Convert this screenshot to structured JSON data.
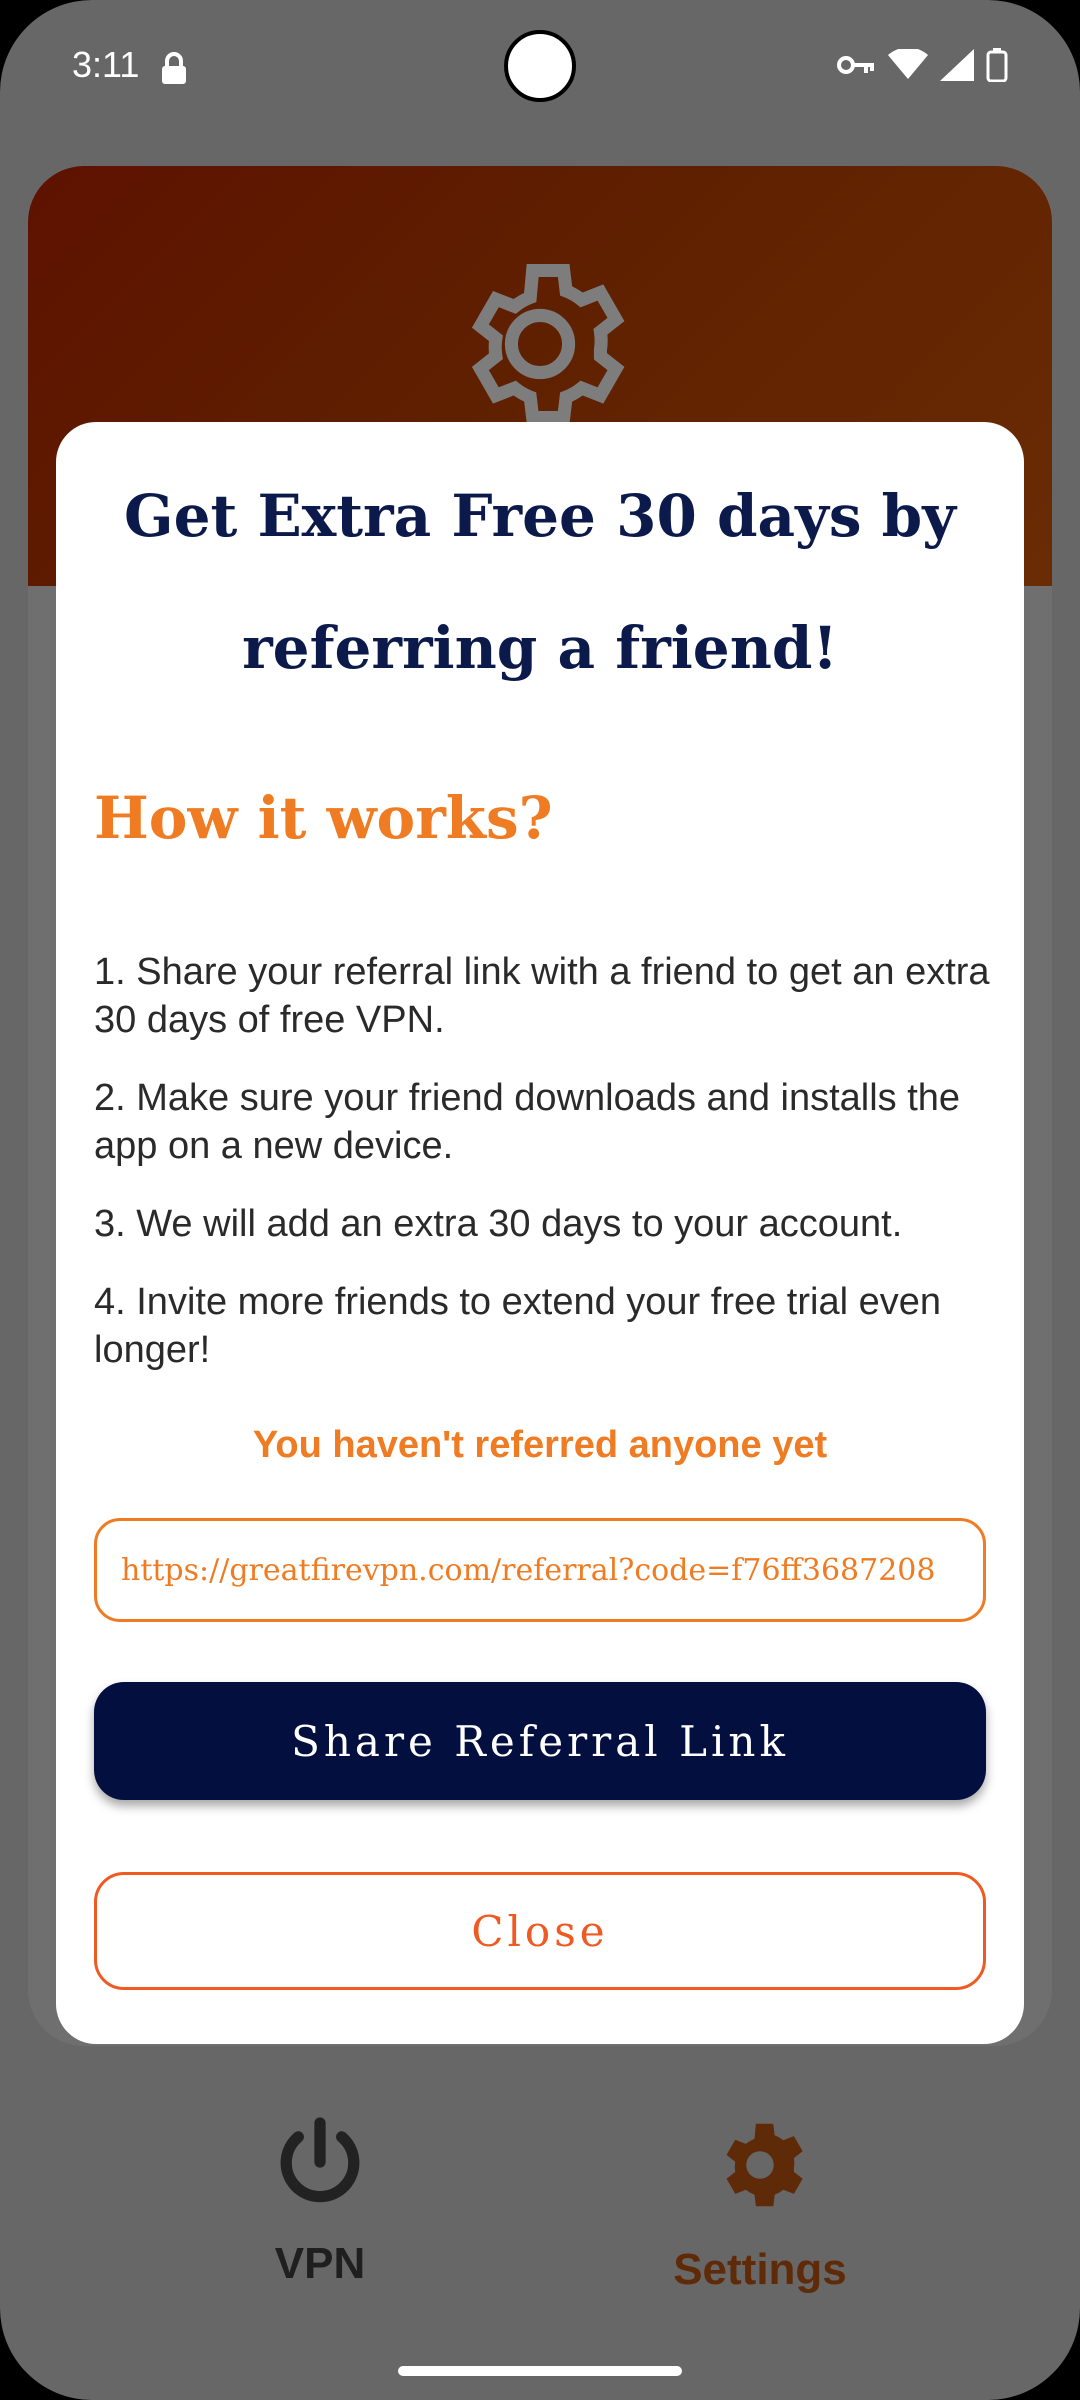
{
  "status_bar": {
    "time": "3:11",
    "icons": [
      "lock-icon",
      "vpn-key-icon",
      "wifi-icon",
      "signal-icon",
      "battery-icon"
    ]
  },
  "background": {
    "header_icon": "gear-icon"
  },
  "dialog": {
    "title": "Get Extra Free 30 days by referring a friend!",
    "how_title": "How it works?",
    "steps": [
      "1. Share your referral link with a friend to get an extra 30 days of free VPN.",
      "2. Make sure your friend downloads and installs the app on a new device.",
      "3. We will add an extra 30 days to your account.",
      "4. Invite more friends to extend your free trial even longer!"
    ],
    "referral_status": "You haven't referred anyone yet",
    "referral_link": "https://greatfirevpn.com/referral?code=f76ff3687208",
    "share_label": "Share Referral Link",
    "close_label": "Close"
  },
  "nav": {
    "vpn_label": "VPN",
    "settings_label": "Settings"
  },
  "colors": {
    "title": "#0b1a4a",
    "accent": "#ef7b22",
    "primary_button": "#03103f",
    "close_border": "#ef5a22"
  }
}
